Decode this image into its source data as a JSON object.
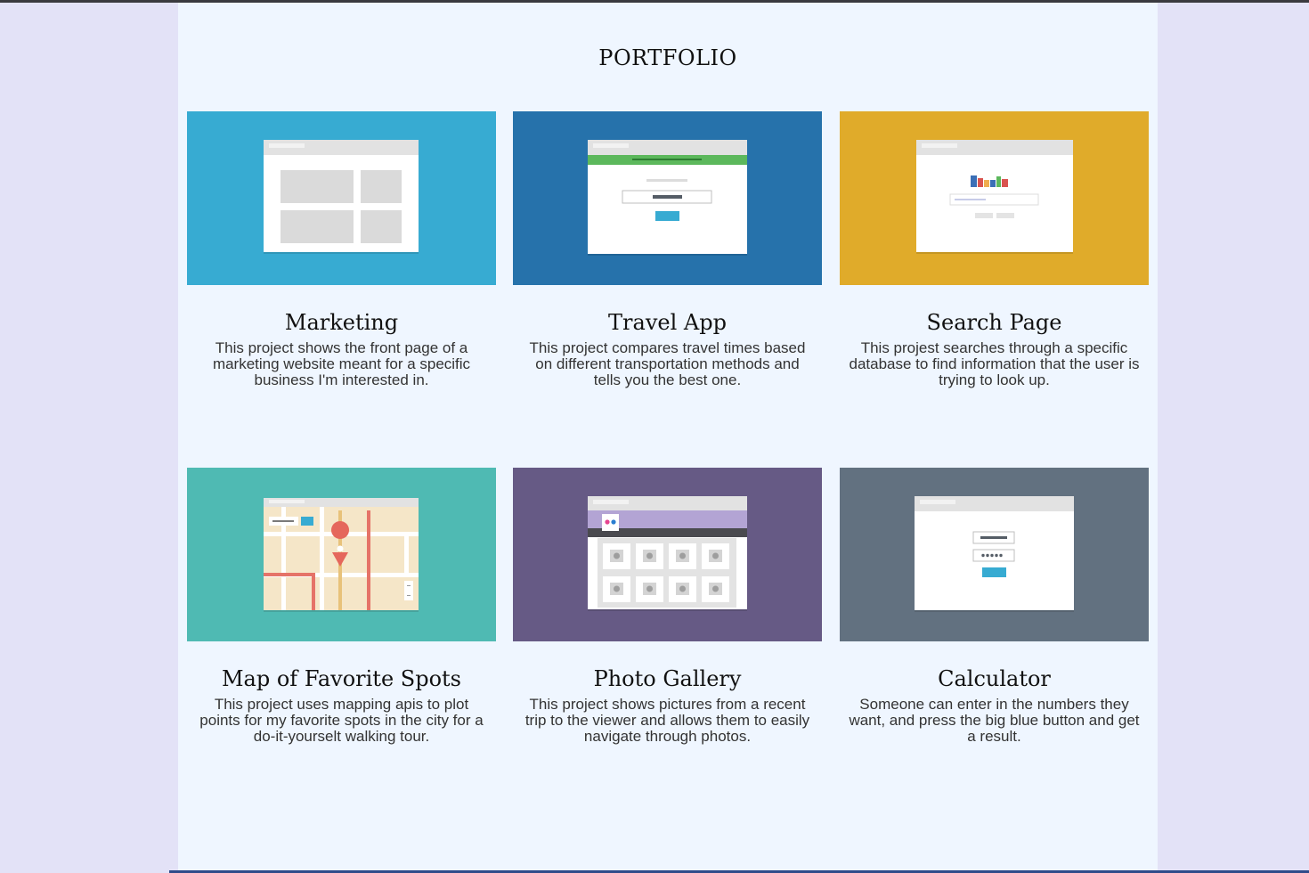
{
  "page": {
    "title": "PORTFOLIO"
  },
  "colors": {
    "background": "#e3e2f7",
    "container": "#eff6ff",
    "marketing": "#37abd2",
    "travel": "#2672ab",
    "search": "#e0ab2a",
    "map": "#4fbab3",
    "gallery": "#665a85",
    "calculator": "#627180"
  },
  "projects": [
    {
      "title": "Marketing",
      "description": "This project shows the front page of a marketing website meant for a specific business I'm interested in.",
      "icon": "marketing-wireframe-icon"
    },
    {
      "title": "Travel App",
      "description": "This project compares travel times based on different transportation methods and tells you the best one.",
      "icon": "travel-app-wireframe-icon"
    },
    {
      "title": "Search Page",
      "description": "This projest searches through a specific database to find information that the user is trying to look up.",
      "icon": "search-page-wireframe-icon"
    },
    {
      "title": "Map of Favorite Spots",
      "description": "This project uses mapping apis to plot points for my favorite spots in the city for a do-it-yourselt walking tour.",
      "icon": "map-wireframe-icon"
    },
    {
      "title": "Photo Gallery",
      "description": "This project shows pictures from a recent trip to the viewer and allows them to easily navigate through photos.",
      "icon": "photo-gallery-wireframe-icon"
    },
    {
      "title": "Calculator",
      "description": "Someone can enter in the numbers they want, and press the big blue button and get a result.",
      "icon": "calculator-wireframe-icon"
    }
  ]
}
